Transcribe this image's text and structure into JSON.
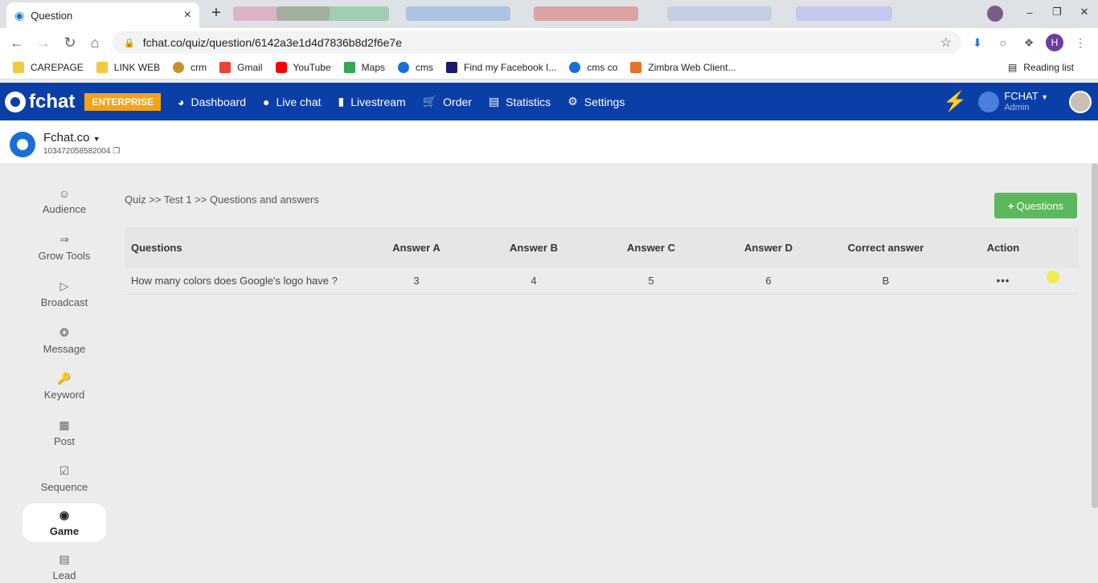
{
  "browser": {
    "tab_title": "Question",
    "url": "fchat.co/quiz/question/6142a3e1d4d7836b8d2f6e7e",
    "bookmarks": [
      "CAREPAGE",
      "LINK WEB",
      "crm",
      "Gmail",
      "YouTube",
      "Maps",
      "cms",
      "Find my Facebook I...",
      "cms co",
      "Zimbra Web Client..."
    ],
    "reading_list": "Reading list",
    "profile_initial": "H"
  },
  "app": {
    "brand": "fchat",
    "plan_badge": "ENTERPRISE",
    "nav": [
      "Dashboard",
      "Live chat",
      "Livestream",
      "Order",
      "Statistics",
      "Settings"
    ],
    "account_name": "FCHAT",
    "account_role": "Admin"
  },
  "page": {
    "name": "Fchat.co",
    "id": "103472058582004"
  },
  "sidebar": [
    {
      "label": "Audience",
      "icon": "user-icon"
    },
    {
      "label": "Grow Tools",
      "icon": "grow-icon"
    },
    {
      "label": "Broadcast",
      "icon": "play-icon"
    },
    {
      "label": "Message",
      "icon": "message-icon"
    },
    {
      "label": "Keyword",
      "icon": "key-icon"
    },
    {
      "label": "Post",
      "icon": "post-icon"
    },
    {
      "label": "Sequence",
      "icon": "calendar-icon"
    },
    {
      "label": "Game",
      "icon": "gamepad-icon"
    },
    {
      "label": "Lead",
      "icon": "lead-icon"
    }
  ],
  "main": {
    "breadcrumb": "Quiz >> Test 1 >> Questions and answers",
    "add_button": "Questions",
    "table": {
      "headers": [
        "Questions",
        "Answer A",
        "Answer B",
        "Answer C",
        "Answer D",
        "Correct answer",
        "Action"
      ],
      "rows": [
        [
          "How many colors does Google's logo have ?",
          "3",
          "4",
          "5",
          "6",
          "B",
          "•••"
        ]
      ]
    }
  }
}
